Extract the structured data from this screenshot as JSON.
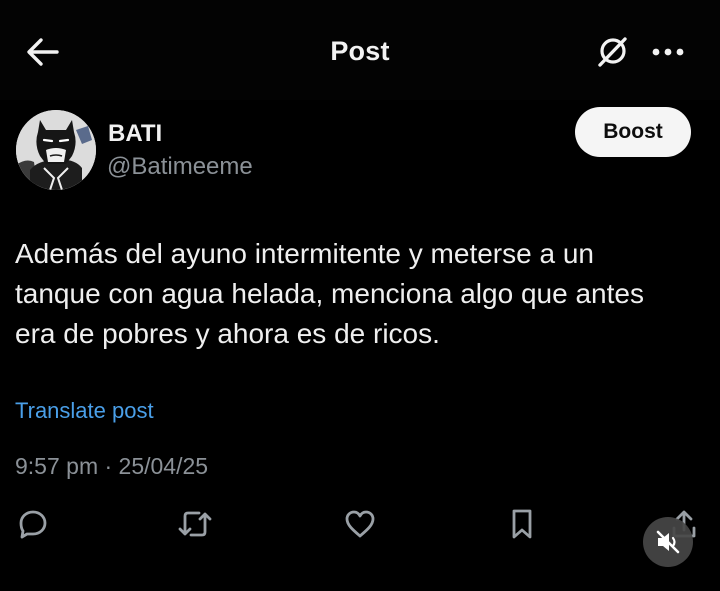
{
  "header": {
    "title": "Post",
    "back_icon": "arrow-left-icon",
    "grok_icon": "grok-icon",
    "more_icon": "more-dots-icon"
  },
  "author": {
    "name": "BATI",
    "handle": "@Batimeeme",
    "avatar_icon": "batman-avatar"
  },
  "boost": {
    "label": "Boost"
  },
  "post": {
    "text": "Además del ayuno intermitente y meterse a un\ntanque con agua helada, menciona algo que antes\nera de pobres y ahora es de ricos.",
    "translate_label": "Translate post",
    "timestamp": "9:57 pm · 25/04/25"
  },
  "actions": [
    {
      "name": "reply",
      "icon": "reply-bubble-icon"
    },
    {
      "name": "repost",
      "icon": "repost-icon"
    },
    {
      "name": "like",
      "icon": "heart-icon"
    },
    {
      "name": "bookmark",
      "icon": "bookmark-icon"
    },
    {
      "name": "share",
      "icon": "share-icon"
    }
  ],
  "video_overlay": {
    "mute_icon": "speaker-muted-icon"
  },
  "colors": {
    "background": "#000000",
    "text": "#efefef",
    "muted": "#8b9197",
    "link": "#4a9fe8",
    "boost_bg": "#f5f5f5"
  }
}
